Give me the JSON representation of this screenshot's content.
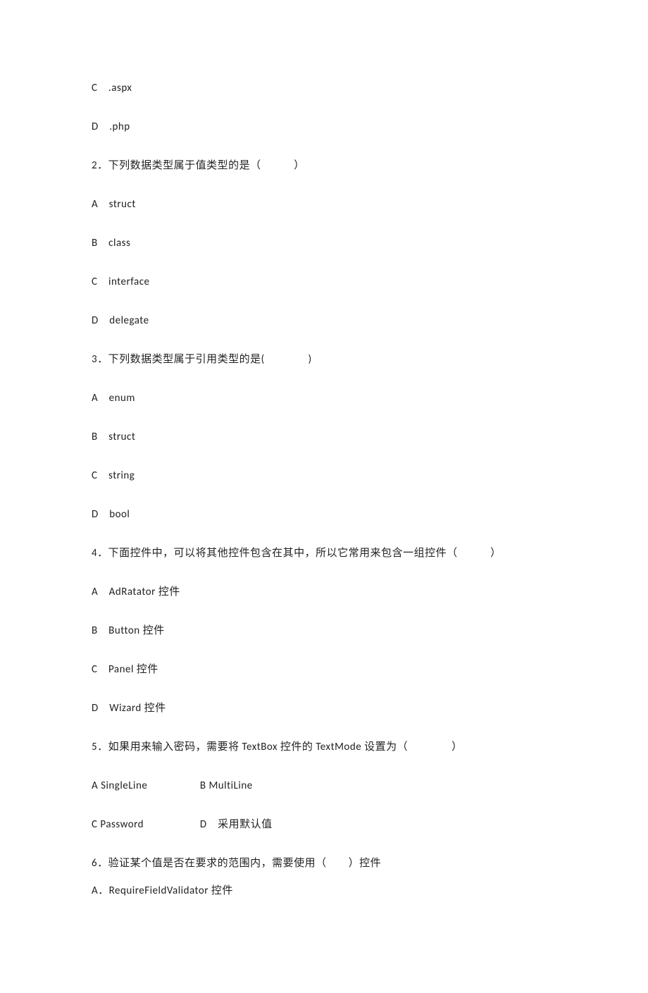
{
  "lines": {
    "l1": "C　.aspx",
    "l2": "D　.php",
    "l3": "2．下列数据类型属于值类型的是（　　　）",
    "l4": "A　struct",
    "l5": "B　class",
    "l6": "C　interface",
    "l7": "D　delegate",
    "l8": "3．下列数据类型属于引用类型的是(　　　　)",
    "l9": "A　enum",
    "l10": "B　struct",
    "l11": "C　string",
    "l12": "D　bool",
    "l13": "4．下面控件中，可以将其他控件包含在其中，所以它常用来包含一组控件（　　　）",
    "l14": "A　AdRatator 控件",
    "l15": "B　Button 控件",
    "l16": "C　Panel 控件",
    "l17": "D　Wizard 控件",
    "l18": "5．如果用来输入密码，需要将 TextBox 控件的 TextMode 设置为（　　　　）",
    "l19a": "A  SingleLine",
    "l19b": "B  MultiLine",
    "l20a": "C  Password",
    "l20b": "D　采用默认值",
    "l21": "6．验证某个值是否在要求的范围内，需要使用（　　）控件",
    "l22": "A．RequireFieldValidator 控件"
  }
}
